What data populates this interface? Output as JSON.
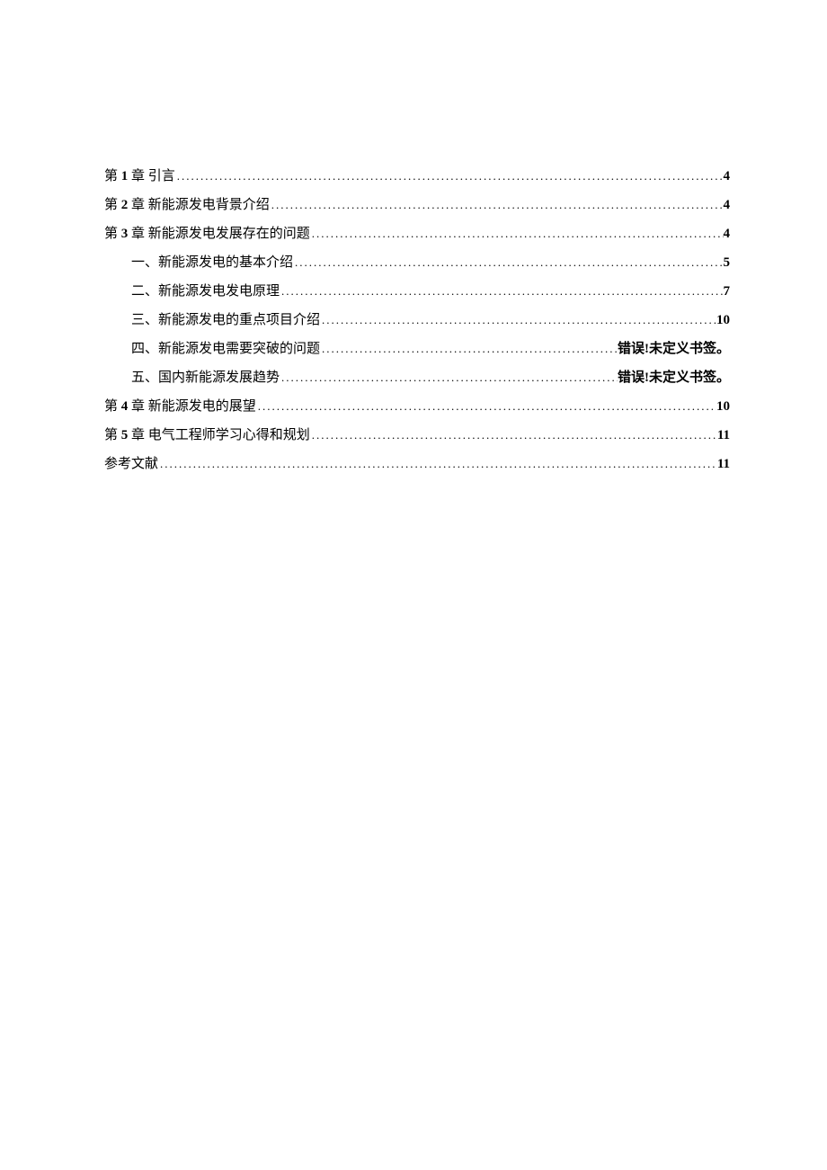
{
  "toc": {
    "entries": [
      {
        "label_prefix": "第 ",
        "label_num": "1",
        "label_suffix": " 章 引言",
        "page": "4",
        "indent": false
      },
      {
        "label_prefix": "第 ",
        "label_num": "2",
        "label_suffix": " 章 新能源发电背景介绍",
        "page": "4",
        "indent": false
      },
      {
        "label_prefix": "第 ",
        "label_num": "3",
        "label_suffix": " 章 新能源发电发展存在的问题",
        "page": "4",
        "indent": false
      },
      {
        "label_prefix": "",
        "label_num": "",
        "label_suffix": "一、新能源发电的基本介绍",
        "page": "5",
        "indent": true
      },
      {
        "label_prefix": "",
        "label_num": "",
        "label_suffix": "二、新能源发电发电原理",
        "page": "7",
        "indent": true
      },
      {
        "label_prefix": "",
        "label_num": "",
        "label_suffix": "三、新能源发电的重点项目介绍",
        "page": "10",
        "indent": true
      },
      {
        "label_prefix": "",
        "label_num": "",
        "label_suffix": "四、新能源发电需要突破的问题",
        "page": "错误!未定义书签。",
        "indent": true,
        "error": true
      },
      {
        "label_prefix": "",
        "label_num": "",
        "label_suffix": "五、国内新能源发展趋势",
        "page": "错误!未定义书签。",
        "indent": true,
        "error": true
      },
      {
        "label_prefix": "第 ",
        "label_num": "4",
        "label_suffix": " 章 新能源发电的展望",
        "page": "10",
        "indent": false
      },
      {
        "label_prefix": "第 ",
        "label_num": "5",
        "label_suffix": " 章 电气工程师学习心得和规划",
        "page": "11",
        "indent": false
      },
      {
        "label_prefix": "",
        "label_num": "",
        "label_suffix": "参考文献",
        "page": "11",
        "indent": false
      }
    ]
  }
}
